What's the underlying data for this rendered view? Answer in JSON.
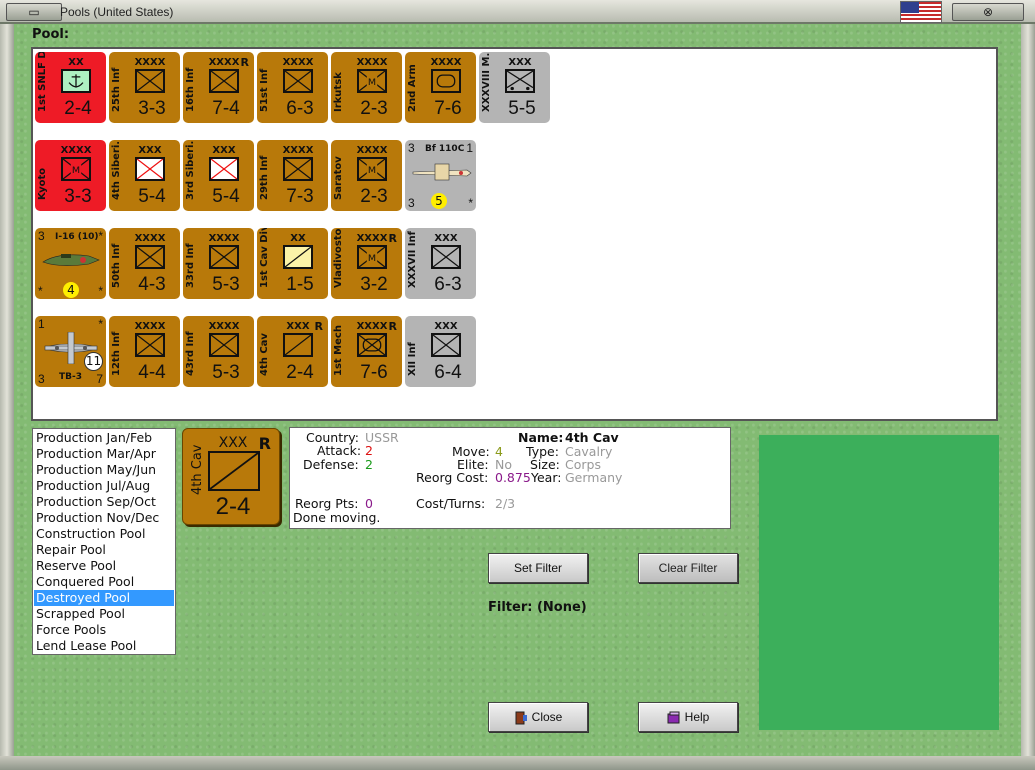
{
  "window": {
    "title": "Pools (United States)",
    "left_button": "▭",
    "right_button": "⊗",
    "flag": "us-flag-icon"
  },
  "pool_label": "Pool:",
  "units": [
    {
      "name": "1st SNLF D.",
      "size": "XX",
      "reserve": "",
      "strength": "2-4",
      "color": "red",
      "symbol": "anchor"
    },
    {
      "name": "25th Inf",
      "size": "XXXX",
      "reserve": "",
      "strength": "3-3",
      "color": "brown",
      "symbol": "infantry"
    },
    {
      "name": "16th Inf",
      "size": "XXXX",
      "reserve": "R",
      "strength": "7-4",
      "color": "brown",
      "symbol": "infantry"
    },
    {
      "name": "51st Inf",
      "size": "XXXX",
      "reserve": "",
      "strength": "6-3",
      "color": "brown",
      "symbol": "infantry"
    },
    {
      "name": "Irkutsk",
      "size": "XXXX",
      "reserve": "",
      "strength": "2-3",
      "color": "brown",
      "symbol": "militia"
    },
    {
      "name": "2nd Arm",
      "size": "XXXX",
      "reserve": "",
      "strength": "7-6",
      "color": "brown",
      "symbol": "armor"
    },
    {
      "name": "XXXVIII M.",
      "size": "XXX",
      "reserve": "",
      "strength": "5-5",
      "color": "grey",
      "symbol": "motorized"
    },
    {
      "name": "Kyoto",
      "size": "XXXX",
      "reserve": "",
      "strength": "3-3",
      "color": "red",
      "symbol": "militia"
    },
    {
      "name": "4th Siberi.",
      "size": "XXX",
      "reserve": "",
      "strength": "5-4",
      "color": "brown",
      "symbol": "infantry-white"
    },
    {
      "name": "3rd Siberi.",
      "size": "XXX",
      "reserve": "",
      "strength": "5-4",
      "color": "brown",
      "symbol": "infantry-white"
    },
    {
      "name": "29th Inf",
      "size": "XXXX",
      "reserve": "",
      "strength": "7-3",
      "color": "brown",
      "symbol": "infantry"
    },
    {
      "name": "Saratov",
      "size": "XXXX",
      "reserve": "",
      "strength": "2-3",
      "color": "brown",
      "symbol": "militia"
    },
    {
      "name": "50th Inf",
      "size": "XXXX",
      "reserve": "",
      "strength": "4-3",
      "color": "brown",
      "symbol": "infantry"
    },
    {
      "name": "33rd Inf",
      "size": "XXXX",
      "reserve": "",
      "strength": "5-3",
      "color": "brown",
      "symbol": "infantry"
    },
    {
      "name": "1st Cav Div",
      "size": "XX",
      "reserve": "",
      "strength": "1-5",
      "color": "brown",
      "symbol": "cavalry-light"
    },
    {
      "name": "Vladivostok",
      "size": "XXXX",
      "reserve": "R",
      "strength": "3-2",
      "color": "brown",
      "symbol": "militia"
    },
    {
      "name": "XXXVII Inf",
      "size": "XXX",
      "reserve": "",
      "strength": "6-3",
      "color": "grey",
      "symbol": "infantry"
    },
    {
      "name": "12th Inf",
      "size": "XXXX",
      "reserve": "",
      "strength": "4-4",
      "color": "brown",
      "symbol": "infantry"
    },
    {
      "name": "43rd Inf",
      "size": "XXXX",
      "reserve": "",
      "strength": "5-3",
      "color": "brown",
      "symbol": "infantry"
    },
    {
      "name": "4th Cav",
      "size": "XXX",
      "reserve": "R",
      "strength": "2-4",
      "color": "brown",
      "symbol": "cavalry"
    },
    {
      "name": "1st Mech",
      "size": "XXXX",
      "reserve": "R",
      "strength": "7-6",
      "color": "brown",
      "symbol": "mech"
    },
    {
      "name": "XII Inf",
      "size": "XXX",
      "reserve": "",
      "strength": "6-4",
      "color": "grey",
      "symbol": "infantry"
    }
  ],
  "air_units": [
    {
      "name": "Bf 110C",
      "top_left": "3",
      "top_right": "1",
      "bottom_left": "3",
      "bottom_right": "*",
      "range": "5",
      "color": "grey"
    },
    {
      "name": "I-16 (10)",
      "top_left": "3",
      "top_right": "*",
      "bottom_left": "*",
      "bottom_right": "*",
      "range": "4",
      "color": "brown"
    },
    {
      "name": "TB-3",
      "top_left": "1",
      "top_right": "*",
      "bottom_left": "3",
      "bottom_right": "7",
      "range": "11",
      "color": "brown"
    }
  ],
  "pool_list": [
    "Production Jan/Feb",
    "Production Mar/Apr",
    "Production May/Jun",
    "Production Jul/Aug",
    "Production Sep/Oct",
    "Production Nov/Dec",
    "Construction Pool",
    "Repair Pool",
    "Reserve Pool",
    "Conquered Pool",
    "Destroyed Pool",
    "Scrapped Pool",
    "Force Pools",
    "Lend Lease Pool"
  ],
  "selected_pool": "Destroyed Pool",
  "selected_unit": {
    "name": "4th Cav",
    "size": "XXX",
    "reserve": "R",
    "strength": "2-4"
  },
  "info": {
    "country_label": "Country:",
    "country": "USSR",
    "attack_label": "Attack:",
    "attack": "2",
    "defense_label": "Defense:",
    "defense": "2",
    "move_label": "Move:",
    "move": "4",
    "elite_label": "Elite:",
    "elite": "No",
    "reorg_cost_label": "Reorg Cost:",
    "reorg_cost": "0.875",
    "reorg_pts_label": "Reorg Pts:",
    "reorg_pts": "0",
    "cost_turns_label": "Cost/Turns:",
    "cost_turns": "2/3",
    "status": "Done moving.",
    "name_label": "Name:",
    "name": "4th Cav",
    "type_label": "Type:",
    "type": "Cavalry",
    "size_label": "Size:",
    "size": "Corps",
    "year_label": "Year:",
    "year": "Germany"
  },
  "buttons": {
    "set_filter": "Set Filter",
    "clear_filter": "Clear Filter",
    "close": "Close",
    "help": "Help"
  },
  "filter": "Filter: (None)"
}
